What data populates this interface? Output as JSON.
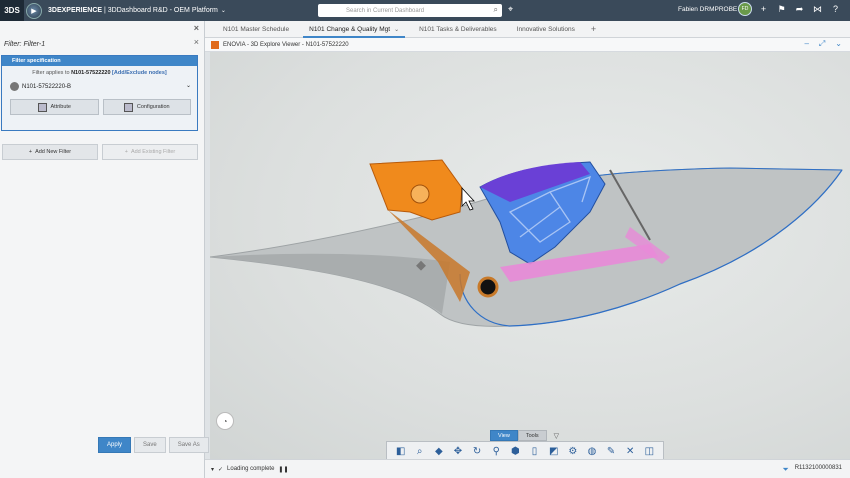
{
  "topbar": {
    "logo": "3DS",
    "compass": "▶",
    "brand_strong": "3DEXPERIENCE",
    "brand_rest": " | 3DDashboard R&D - OEM Platform",
    "brand_chevron": "⌄",
    "search_placeholder": "Search in Current Dashboard",
    "user": "Fabien DRMPROBE",
    "icons": [
      "avatar-icon",
      "plus-icon",
      "flag-icon",
      "share-icon",
      "network-icon",
      "help-icon"
    ]
  },
  "left_panel": {
    "header": "",
    "filter_title": "Filter: Filter-1",
    "spec_title": "Filter specification",
    "applies_prefix": "Filter applies to",
    "applies_id": "N101-57522220",
    "applies_link": "[Add/Exclude nodes]",
    "selected_node": "N101-57522220-B",
    "attribute_btn": "Attribute",
    "configuration_btn": "Configuration",
    "add_new_filter": "Add New Filter",
    "add_existing_filter": "Add Existing Filter",
    "apply": "Apply",
    "save": "Save",
    "save_as": "Save As"
  },
  "tabs": [
    {
      "label": "N101 Master Schedule"
    },
    {
      "label": "N101 Change & Quality Mgt"
    },
    {
      "label": "N101 Tasks & Deliverables"
    },
    {
      "label": "Innovative Solutions"
    }
  ],
  "tab_chevron": "⌄",
  "tab_plus": "+",
  "viewer_header": {
    "title": "ENOVIA - 3D Explore Viewer - N101-57522220"
  },
  "toolbar": {
    "tabs": [
      "View",
      "Tools"
    ],
    "tab_arrow": "▽",
    "icons": [
      "panel-icon",
      "zoom-icon",
      "cube-icon",
      "pan-icon",
      "rotate-icon",
      "measure-icon",
      "box-icon",
      "fit-icon",
      "section-icon",
      "explode-icon",
      "ghost-icon",
      "annotate-icon",
      "close-icon",
      "split-icon"
    ]
  },
  "status": {
    "loading": "Loading complete",
    "code": "R1132100000831"
  }
}
